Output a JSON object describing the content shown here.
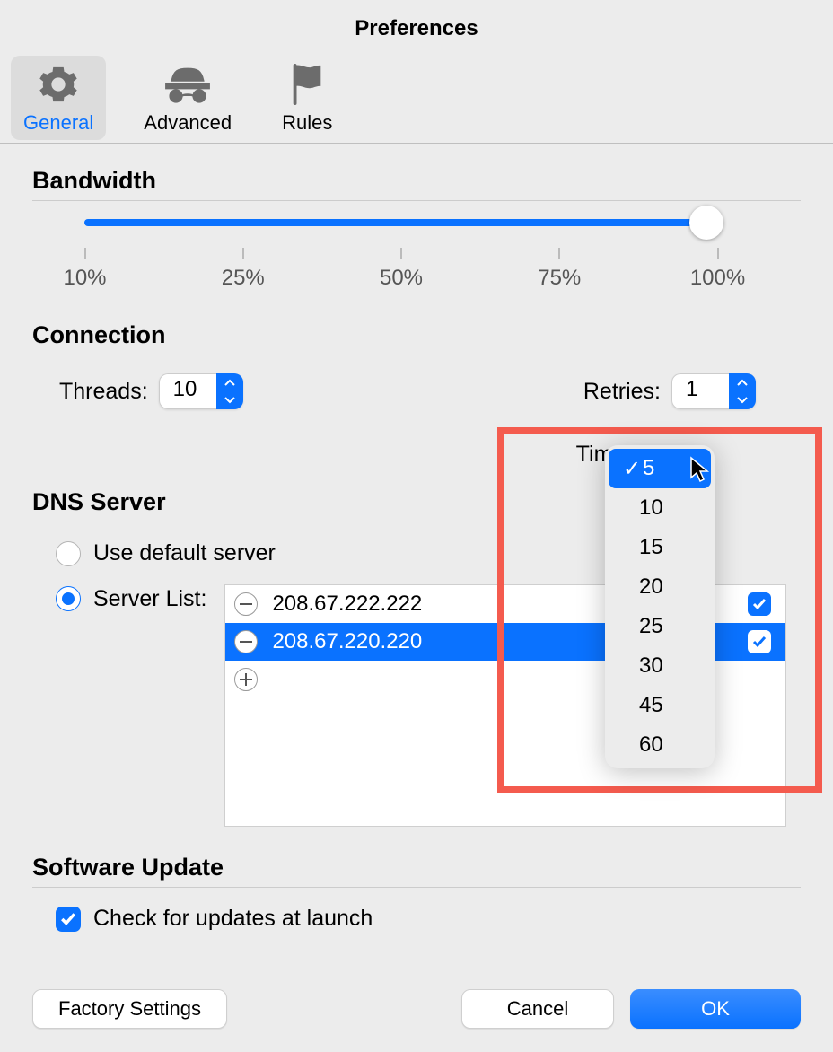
{
  "window": {
    "title": "Preferences"
  },
  "tabs": {
    "general": "General",
    "advanced": "Advanced",
    "rules": "Rules"
  },
  "bandwidth": {
    "title": "Bandwidth",
    "ticks": [
      "10%",
      "25%",
      "50%",
      "75%",
      "100%"
    ],
    "valuePercent": 100
  },
  "connection": {
    "title": "Connection",
    "threadsLabel": "Threads:",
    "threadsValue": "10",
    "retriesLabel": "Retries:",
    "retriesValue": "1",
    "timeoutLabel": "Timeout:",
    "timeoutSelected": "5",
    "timeoutOptions": [
      "5",
      "10",
      "15",
      "20",
      "25",
      "30",
      "45",
      "60"
    ]
  },
  "dns": {
    "title": "DNS Server",
    "useDefault": "Use default server",
    "serverListLabel": "Server List:",
    "servers": [
      {
        "ip": "208.67.222.222",
        "enabled": true,
        "selected": false
      },
      {
        "ip": "208.67.220.220",
        "enabled": true,
        "selected": true
      }
    ]
  },
  "update": {
    "title": "Software Update",
    "checkAtLaunch": "Check for updates at launch"
  },
  "buttons": {
    "factory": "Factory Settings",
    "cancel": "Cancel",
    "ok": "OK"
  }
}
